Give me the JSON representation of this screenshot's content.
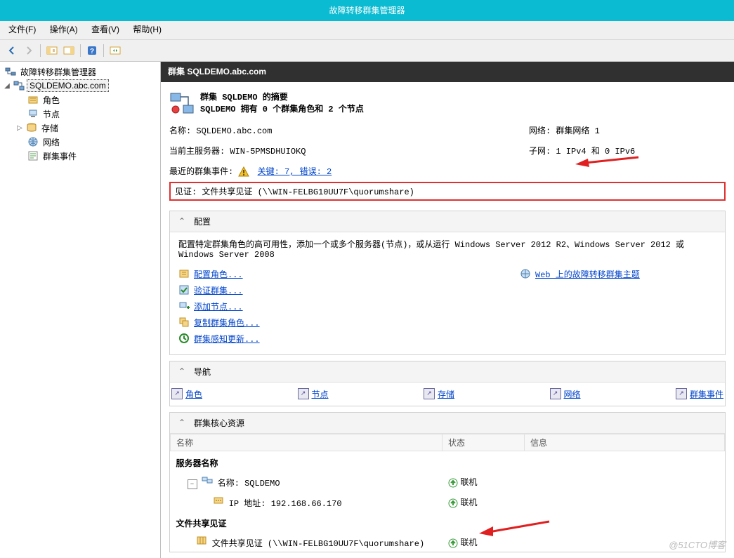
{
  "window": {
    "title": "故障转移群集管理器"
  },
  "menu": {
    "file": "文件(F)",
    "operation": "操作(A)",
    "view": "查看(V)",
    "help": "帮助(H)"
  },
  "tree": {
    "root": "故障转移群集管理器",
    "cluster": "SQLDEMO.abc.com",
    "roles": "角色",
    "nodes": "节点",
    "storage": "存储",
    "network": "网络",
    "events": "群集事件"
  },
  "header": {
    "title": "群集 SQLDEMO.abc.com"
  },
  "summary": {
    "title1": "群集 SQLDEMO 的摘要",
    "title2": "SQLDEMO 拥有 0 个群集角色和 2 个节点",
    "name_k": "名称:",
    "name_v": "SQLDEMO.abc.com",
    "host_k": "当前主服务器:",
    "host_v": "WIN-5PMSDHUIOKQ",
    "network_k": "网络:",
    "network_v": "群集网络 1",
    "subnet_k": "子网:",
    "subnet_v": "1 IPv4 和 0 IPv6",
    "events_k": "最近的群集事件:",
    "events_link": "关键: 7, 错误: 2",
    "witness_k": "见证:",
    "witness_v": "文件共享见证 (\\\\WIN-FELBG10UU7F\\quorumshare)"
  },
  "config": {
    "header": "配置",
    "desc_a": "配置特定群集角色的高可用性，添加一个或多个服务器(节点)，或从运行 ",
    "desc_b": "Windows Server 2012 R2、Windows Server 2012 或 Windows Server 2008 ",
    "links": {
      "configure_role": "配置角色...",
      "validate_cluster": "验证群集...",
      "add_node": "添加节点...",
      "copy_role": "复制群集角色...",
      "update_aware": "群集感知更新..."
    },
    "web_link": "Web 上的故障转移群集主题"
  },
  "nav": {
    "header": "导航",
    "roles": "角色",
    "nodes": "节点",
    "storage": "存储",
    "network": "网络",
    "events": "群集事件"
  },
  "resources": {
    "header": "群集核心资源",
    "cols": {
      "name": "名称",
      "status": "状态",
      "info": "信息"
    },
    "group_server": "服务器名称",
    "row_server_name": "名称: SQLDEMO",
    "row_ip": "IP 地址: 192.168.66.170",
    "group_witness": "文件共享见证",
    "row_witness": "文件共享见证 (\\\\WIN-FELBG10UU7F\\quorumshare)",
    "status_online": "联机"
  },
  "watermark": "@51CTO博客"
}
